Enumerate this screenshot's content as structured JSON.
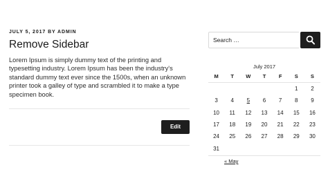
{
  "post": {
    "meta": "July 5, 2017 by admin",
    "title": "Remove Sidebar",
    "excerpt": "Lorem Ipsum is simply dummy text of the printing and typesetting industry. Lorem Ipsum has been the industry's standard dummy text ever since the 1500s, when an unknown printer took a galley of type and scrambled it to make a type specimen book.",
    "edit_label": "Edit"
  },
  "search": {
    "placeholder": "Search …",
    "button_icon": "search-icon"
  },
  "calendar": {
    "caption": "July 2017",
    "weekdays": [
      "M",
      "T",
      "W",
      "T",
      "F",
      "S",
      "S"
    ],
    "weeks": [
      [
        "",
        "",
        "",
        "",
        "",
        "1",
        "2"
      ],
      [
        "3",
        "4",
        "5",
        "6",
        "7",
        "8",
        "9"
      ],
      [
        "10",
        "11",
        "12",
        "13",
        "14",
        "15",
        "16"
      ],
      [
        "17",
        "18",
        "19",
        "20",
        "21",
        "22",
        "23"
      ],
      [
        "24",
        "25",
        "26",
        "27",
        "28",
        "29",
        "30"
      ],
      [
        "31",
        "",
        "",
        "",
        "",
        "",
        ""
      ]
    ],
    "linked_day": "5",
    "prev_link": "« May"
  }
}
